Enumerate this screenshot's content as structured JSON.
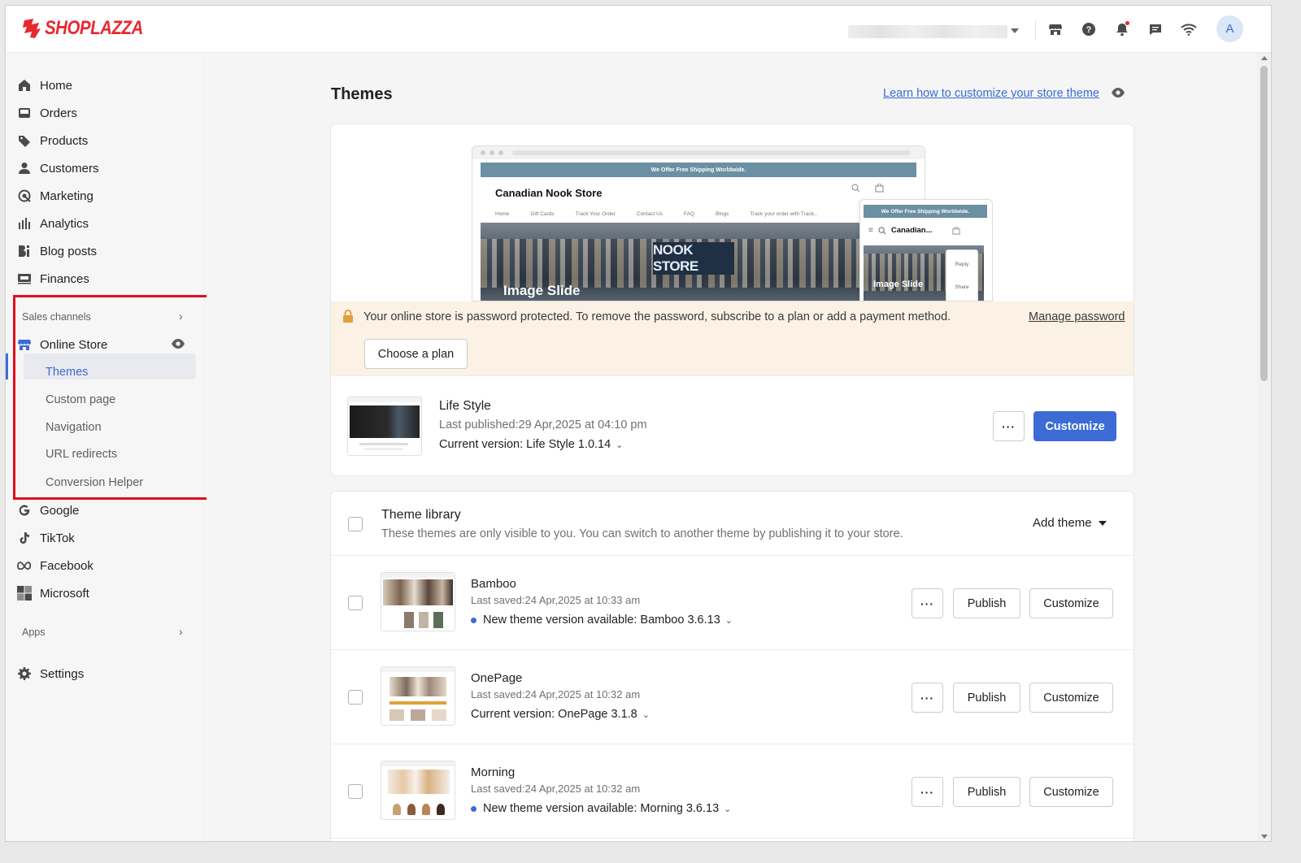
{
  "app": {
    "brand": "SHOPLAZZA",
    "brand_color": "#e8282f",
    "accent_color": "#3c6bd6",
    "avatar_initial": "A"
  },
  "topbar": {
    "icons": [
      "storefront-icon",
      "help-icon",
      "bell-icon",
      "chat-icon",
      "wifi-icon"
    ]
  },
  "sidebar": {
    "items": [
      {
        "label": "Home",
        "icon": "home-icon"
      },
      {
        "label": "Orders",
        "icon": "orders-icon"
      },
      {
        "label": "Products",
        "icon": "tag-icon"
      },
      {
        "label": "Customers",
        "icon": "person-icon"
      },
      {
        "label": "Marketing",
        "icon": "marketing-icon"
      },
      {
        "label": "Analytics",
        "icon": "bar-chart-icon"
      },
      {
        "label": "Blog posts",
        "icon": "blog-icon"
      },
      {
        "label": "Finances",
        "icon": "finance-icon"
      }
    ],
    "sales_channels_label": "Sales channels",
    "online_store_label": "Online Store",
    "online_store_sub": [
      "Themes",
      "Custom page",
      "Navigation",
      "URL redirects",
      "Conversion Helper"
    ],
    "channels": [
      {
        "label": "Google",
        "icon": "google-icon"
      },
      {
        "label": "TikTok",
        "icon": "tiktok-icon"
      },
      {
        "label": "Facebook",
        "icon": "meta-icon"
      },
      {
        "label": "Microsoft",
        "icon": "microsoft-icon"
      }
    ],
    "apps_label": "Apps",
    "settings_label": "Settings"
  },
  "page": {
    "title": "Themes",
    "learn_link": "Learn how to customize your store theme"
  },
  "preview": {
    "banner": "We Offer Free Shipping Worldwide.",
    "store_name": "Canadian Nook Store",
    "mobile_store_name": "Canadian...",
    "nav": [
      "Home",
      "Gift Cards",
      "Track Your Order",
      "Contact Us",
      "FAQ",
      "Blogs",
      "Track your order with Track..."
    ],
    "sign_text": "NOOK STORE",
    "slide_label": "Image Slide",
    "reply_label": "Reply",
    "share_label": "Share"
  },
  "password_banner": {
    "text": "Your online store is password protected. To remove the password, subscribe to a plan or add a payment method.",
    "manage_link": "Manage password",
    "button": "Choose a plan"
  },
  "current_theme": {
    "name": "Life Style",
    "published": "Last published:29 Apr,2025 at 04:10 pm",
    "version": "Current version: Life Style 1.0.14",
    "more_label": "···",
    "customize_label": "Customize"
  },
  "library": {
    "title": "Theme library",
    "subtitle": "These themes are only visible to you. You can switch to another theme by publishing it to your store.",
    "add_theme": "Add theme",
    "themes": [
      {
        "name": "Bamboo",
        "saved": "Last saved:24 Apr,2025 at 10:33 am",
        "version": "New theme version available: Bamboo 3.6.13",
        "has_update": true
      },
      {
        "name": "OnePage",
        "saved": "Last saved:24 Apr,2025 at 10:32 am",
        "version": "Current version: OnePage 3.1.8",
        "has_update": false
      },
      {
        "name": "Morning",
        "saved": "Last saved:24 Apr,2025 at 10:32 am",
        "version": "New theme version available: Morning 3.6.13",
        "has_update": true
      }
    ],
    "more_label": "···",
    "publish_label": "Publish",
    "customize_label": "Customize"
  }
}
